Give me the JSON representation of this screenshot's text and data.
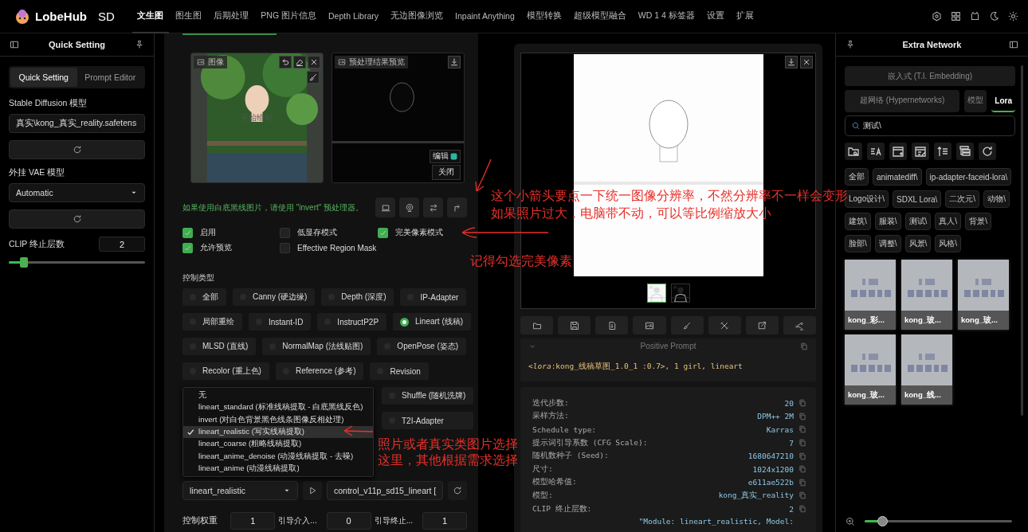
{
  "app": {
    "name": "LobeHub",
    "suffix": "SD"
  },
  "nav_tabs": [
    {
      "label": "文生图",
      "selected": true
    },
    {
      "label": "图生图",
      "selected": false
    },
    {
      "label": "后期处理",
      "selected": false
    },
    {
      "label": "PNG 图片信息",
      "selected": false
    },
    {
      "label": "Depth Library",
      "selected": false
    },
    {
      "label": "无边图像浏览",
      "selected": false
    },
    {
      "label": "Inpaint Anything",
      "selected": false
    },
    {
      "label": "模型转换",
      "selected": false
    },
    {
      "label": "超级模型融合",
      "selected": false
    },
    {
      "label": "WD 1 4 标签器",
      "selected": false
    },
    {
      "label": "设置",
      "selected": false
    },
    {
      "label": "扩展",
      "selected": false
    }
  ],
  "quick_setting": {
    "title": "Quick Setting",
    "tabs": [
      {
        "label": "Quick Setting",
        "selected": true
      },
      {
        "label": "Prompt Editor",
        "selected": false
      }
    ],
    "sd_model_label": "Stable Diffusion 模型",
    "sd_model": "真实\\kong_真实_reality.safetens",
    "vae_label": "外挂 VAE 模型",
    "vae": "Automatic",
    "clip_label": "CLIP 终止层数",
    "clip_value": "2",
    "clip_slider": {
      "level": 0.11
    }
  },
  "controlnet": {
    "image_label": "图像",
    "start_draw": "开始绘制",
    "preview_label": "预处理结果预览",
    "edit_label": "编辑",
    "close_label": "关闭",
    "hint": "如果使用白底黑线图片，请使用 \"invert\" 预处理器。",
    "options": [
      {
        "label": "启用",
        "checked": true
      },
      {
        "label": "低显存模式",
        "checked": false
      },
      {
        "label": "完美像素模式",
        "checked": true
      },
      {
        "label": "允许预览",
        "checked": true
      },
      {
        "label": "Effective Region Mask",
        "checked": false
      }
    ],
    "control_type_label": "控制类型",
    "control_types": [
      {
        "label": "全部",
        "selected": false
      },
      {
        "label": "Canny (硬边缘)",
        "selected": false
      },
      {
        "label": "Depth (深度)",
        "selected": false
      },
      {
        "label": "IP-Adapter",
        "selected": false
      },
      {
        "label": "局部重绘",
        "selected": false
      },
      {
        "label": "Instant-ID",
        "selected": false
      },
      {
        "label": "InstructP2P",
        "selected": false
      },
      {
        "label": "Lineart (线稿)",
        "selected": true
      },
      {
        "label": "MLSD (直线)",
        "selected": false
      },
      {
        "label": "NormalMap (法线贴图)",
        "selected": false
      },
      {
        "label": "OpenPose (姿态)",
        "selected": false
      },
      {
        "label": "Recolor (重上色)",
        "selected": false
      },
      {
        "label": "Reference (参考)",
        "selected": false
      },
      {
        "label": "Revision",
        "selected": false
      },
      {
        "label": "Shuffle (随机洗牌)",
        "selected": false
      },
      {
        "label": "T2I-Adapter",
        "selected": false
      }
    ],
    "preprocessor_menu": [
      {
        "label": "无",
        "selected": false
      },
      {
        "label": "lineart_standard (标准线稿提取 - 白底黑线反色)",
        "selected": false
      },
      {
        "label": "invert (对白色背景黑色线条图像反相处理)",
        "selected": false
      },
      {
        "label": "lineart_realistic (写实线稿提取)",
        "selected": true
      },
      {
        "label": "lineart_coarse (粗略线稿提取)",
        "selected": false
      },
      {
        "label": "lineart_anime_denoise (动漫线稿提取 - 去噪)",
        "selected": false
      },
      {
        "label": "lineart_anime (动漫线稿提取)",
        "selected": false
      }
    ],
    "preprocessor": "lineart_realistic",
    "model": "control_v11p_sd15_lineart [",
    "weight_label": "控制权重",
    "weight": "1",
    "start_label": "引导介入...",
    "start": "0",
    "end_label": "引导终止...",
    "end": "1"
  },
  "output": {
    "thumbnails": [
      {
        "selected": true
      },
      {
        "selected": false
      }
    ],
    "prompt_title": "Positive Prompt",
    "prompt": "<*lora*:kong_线稿草图_1.0_1 :0.7>, 1 girl, lineart",
    "params": [
      {
        "label": "迭代步数:",
        "value": "20"
      },
      {
        "label": "采样方法:",
        "value": "DPM++ 2M"
      },
      {
        "label": "Schedule type:",
        "value": "Karras"
      },
      {
        "label": "提示词引导系数 (CFG Scale):",
        "value": "7"
      },
      {
        "label": "随机数种子 (Seed):",
        "value": "1680647210"
      },
      {
        "label": "尺寸:",
        "value": "1024x1200"
      },
      {
        "label": "模型哈希值:",
        "value": "e611ae522b"
      },
      {
        "label": "模型:",
        "value": "kong_真实_reality"
      },
      {
        "label": "CLIP 终止层数:",
        "value": "2"
      }
    ],
    "module_text": "\"Module: lineart_realistic, Model:"
  },
  "extra_network": {
    "title": "Extra Network",
    "tabs": [
      {
        "label": "嵌入式 (T.I. Embedding)",
        "selected": false
      },
      {
        "label": "超网络 (Hypernetworks)",
        "selected": false
      },
      {
        "label": "模型",
        "selected": false
      },
      {
        "label": "Lora",
        "selected": true
      }
    ],
    "search": "测试\\",
    "tags": [
      "全部",
      "animatediff\\",
      "ip-adapter-faceid-lora\\",
      "Logo设计\\",
      "SDXL Lora\\",
      "二次元\\",
      "动物\\",
      "建筑\\",
      "服装\\",
      "测试\\",
      "真人\\",
      "背景\\",
      "脸部\\",
      "调整\\",
      "风景\\",
      "风格\\"
    ],
    "cards": [
      {
        "name": "kong_彩..."
      },
      {
        "name": "kong_玻..."
      },
      {
        "name": "kong_玻..."
      },
      {
        "name": "kong_玻..."
      },
      {
        "name": "kong_线..."
      }
    ],
    "zoom_slider": {
      "level": 0.12
    }
  },
  "annotations": [
    {
      "text": "这个小箭头要点一下统一图像分辨率，不然分辨率不一样会变形"
    },
    {
      "text": "如果照片过大，电脑带不动，可以等比例缩放大小"
    },
    {
      "text": "记得勾选完美像素"
    },
    {
      "text": "照片或者真实类图片选择这里，其他根据需求选择"
    }
  ]
}
